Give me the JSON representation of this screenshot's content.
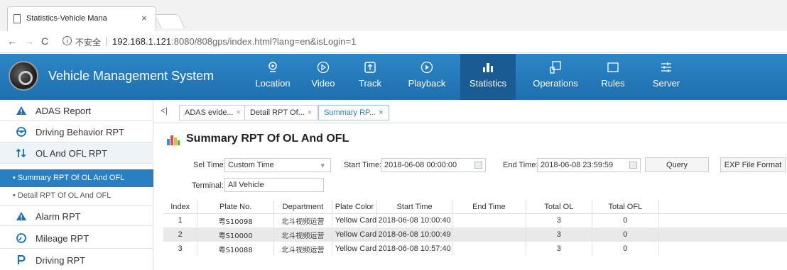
{
  "browser": {
    "tab_title": "Statistics-Vehicle Mana",
    "tab_close": "×",
    "secure_label": "不安全",
    "url_host": "192.168.1.121",
    "url_path": ":8080/808gps/index.html?lang=en&isLogin=1"
  },
  "app": {
    "title": "Vehicle Management System",
    "menu": [
      {
        "label": "Location",
        "icon": "location-pin-icon"
      },
      {
        "label": "Video",
        "icon": "video-play-icon"
      },
      {
        "label": "Track",
        "icon": "track-icon"
      },
      {
        "label": "Playback",
        "icon": "playback-icon"
      },
      {
        "label": "Statistics",
        "icon": "bar-chart-icon",
        "active": true
      },
      {
        "label": "Operations",
        "icon": "operations-icon"
      },
      {
        "label": "Rules",
        "icon": "rules-icon"
      },
      {
        "label": "Server",
        "icon": "server-icon"
      }
    ],
    "accent_color": "#2a7fc2"
  },
  "sidebar": {
    "items": [
      {
        "label": "ADAS Report",
        "icon": "warning-triangle-icon"
      },
      {
        "label": "Driving Behavior RPT",
        "icon": "steering-wheel-icon"
      },
      {
        "label": "OL And OFL RPT",
        "icon": "up-down-arrows-icon"
      },
      {
        "label": "Summary RPT Of OL And OFL",
        "sub": true,
        "selected": true
      },
      {
        "label": "Detail RPT Of OL And OFL",
        "sub": true
      },
      {
        "label": "Alarm RPT",
        "icon": "warning-triangle-icon"
      },
      {
        "label": "Mileage RPT",
        "icon": "speedometer-icon"
      },
      {
        "label": "Driving RPT",
        "icon": "p-letter-icon"
      }
    ]
  },
  "tabs": {
    "collapse": "<|",
    "items": [
      {
        "label": "ADAS evide...",
        "close": "×"
      },
      {
        "label": "Detail RPT Of...",
        "close": "×"
      },
      {
        "label": "Summary RP...",
        "close": "×",
        "active": true
      }
    ]
  },
  "page": {
    "title": "Summary RPT Of OL And OFL"
  },
  "filters": {
    "sel_time_label": "Sel Time:",
    "sel_time_value": "Custom Time",
    "start_time_label": "Start Time:",
    "start_time_value": "2018-06-08 00:00:00",
    "end_time_label": "End Time:",
    "end_time_value": "2018-06-08 23:59:59",
    "query_button": "Query",
    "export_button": "EXP File Format",
    "terminal_label": "Terminal:",
    "terminal_value": "All Vehicle"
  },
  "table": {
    "columns": [
      "Index",
      "Plate No.",
      "Department",
      "Plate Color",
      "Start Time",
      "End Time",
      "Total OL",
      "Total OFL"
    ],
    "rows": [
      [
        "1",
        "粤S10098",
        "北斗视频运营",
        "Yellow Card",
        "2018-06-08 10:00:40",
        "",
        "3",
        "0"
      ],
      [
        "2",
        "粤S10000",
        "北斗视频运营",
        "Yellow Card",
        "2018-06-08 10:00:49",
        "",
        "3",
        "0"
      ],
      [
        "3",
        "粤S10088",
        "北斗视频运营",
        "Yellow Card",
        "2018-06-08 10:57:40",
        "",
        "3",
        "0"
      ]
    ]
  }
}
